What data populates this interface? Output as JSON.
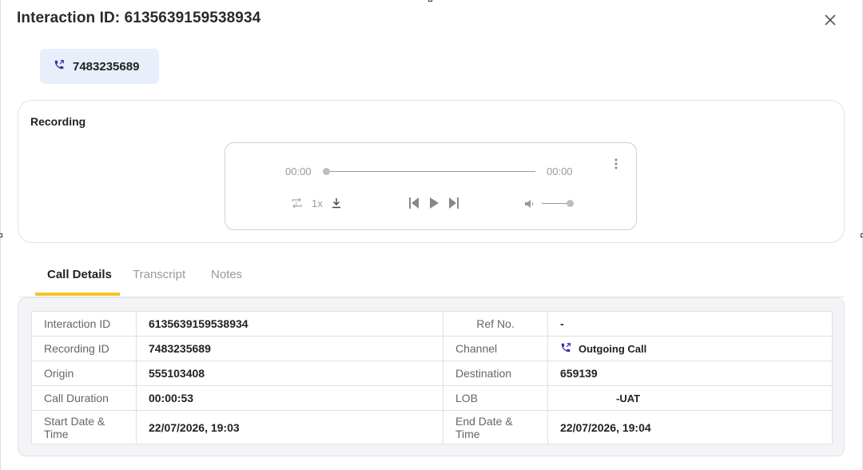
{
  "modal": {
    "title": "Interaction ID: 6135639159538934",
    "close_icon": "close-icon"
  },
  "phone_chip": {
    "number": "7483235689",
    "icon": "phone-outgoing-icon"
  },
  "recording": {
    "title": "Recording",
    "player": {
      "current_time": "00:00",
      "total_time": "00:00",
      "speed": "1x",
      "progress": 0,
      "volume": 1.0,
      "icons": [
        "repeat-icon",
        "download-icon",
        "skip-back-icon",
        "play-icon",
        "skip-forward-icon",
        "volume-icon",
        "more-vertical-icon"
      ]
    }
  },
  "tabs": [
    {
      "label": "Call Details",
      "active": true
    },
    {
      "label": "Transcript",
      "active": false
    },
    {
      "label": "Notes",
      "active": false
    }
  ],
  "details": {
    "rows": [
      {
        "l1": "Interaction ID",
        "v1": "6135639159538934",
        "l2": "Ref No.",
        "v2": "-"
      },
      {
        "l1": "Recording ID",
        "v1": "7483235689",
        "l2": "Channel",
        "v2": "Outgoing Call"
      },
      {
        "l1": "Origin",
        "v1": "555103408",
        "l2": "Destination",
        "v2": "659139"
      },
      {
        "l1": "Call Duration",
        "v1": "00:00:53",
        "l2": "LOB",
        "v2": "-UAT"
      },
      {
        "l1": "Start Date & Time",
        "v1": "22/07/2026, 19:03",
        "l2": "End Date & Time",
        "v2": "22/07/2026, 19:04"
      }
    ]
  },
  "colors": {
    "accent": "#f3c623",
    "chip_bg": "#e9eefb",
    "phone_icon": "#3b2aa8"
  }
}
